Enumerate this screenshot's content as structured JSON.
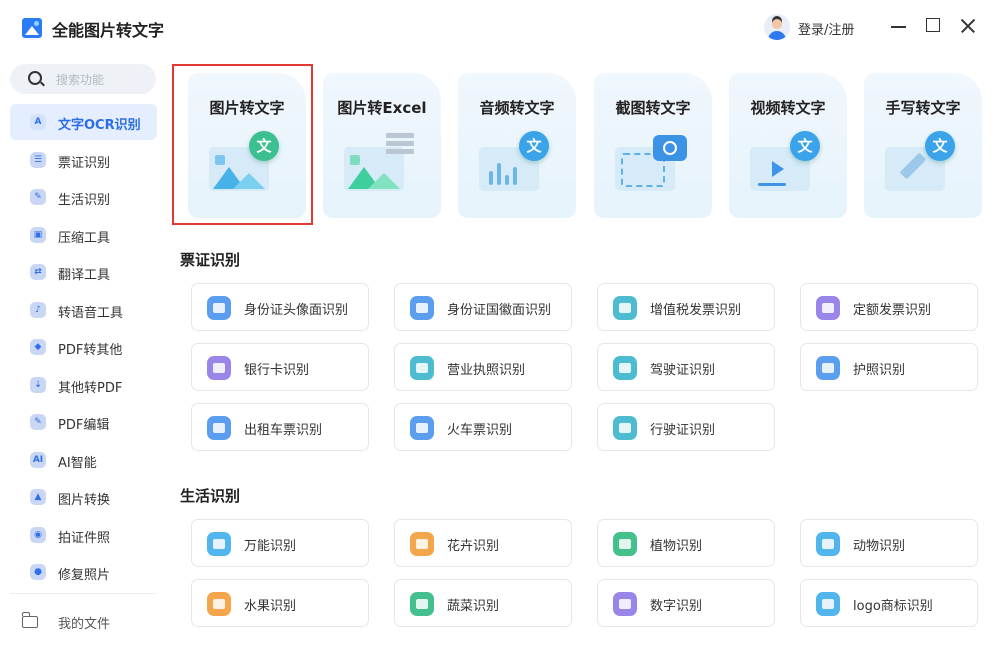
{
  "app": {
    "title": "全能图片转文字"
  },
  "header": {
    "login_label": "登录/注册"
  },
  "search": {
    "placeholder": "搜索功能"
  },
  "sidebar": {
    "items": [
      {
        "label": "文字OCR识别",
        "icon": "A"
      },
      {
        "label": "票证识别",
        "icon": "☰"
      },
      {
        "label": "生活识别",
        "icon": "✎"
      },
      {
        "label": "压缩工具",
        "icon": "▣"
      },
      {
        "label": "翻译工具",
        "icon": "⇄"
      },
      {
        "label": "转语音工具",
        "icon": "♪"
      },
      {
        "label": "PDF转其他",
        "icon": "◆"
      },
      {
        "label": "其他转PDF",
        "icon": "⇣"
      },
      {
        "label": "PDF编辑",
        "icon": "✎"
      },
      {
        "label": "AI智能",
        "icon": "AI"
      },
      {
        "label": "图片转换",
        "icon": "▲"
      },
      {
        "label": "拍证件照",
        "icon": "◉"
      },
      {
        "label": "修复照片",
        "icon": "●"
      }
    ],
    "my_files": "我的文件"
  },
  "features": [
    {
      "label": "图片转文字",
      "badge": "文"
    },
    {
      "label": "图片转Excel"
    },
    {
      "label": "音频转文字",
      "badge": "文"
    },
    {
      "label": "截图转文字"
    },
    {
      "label": "视频转文字",
      "badge": "文"
    },
    {
      "label": "手写转文字",
      "badge": "文"
    }
  ],
  "sections": {
    "tickets": {
      "title": "票证识别",
      "items": [
        "身份证头像面识别",
        "身份证国徽面识别",
        "增值税发票识别",
        "定额发票识别",
        "银行卡识别",
        "营业执照识别",
        "驾驶证识别",
        "护照识别",
        "出租车票识别",
        "火车票识别",
        "行驶证识别"
      ]
    },
    "life": {
      "title": "生活识别",
      "items": [
        "万能识别",
        "花卉识别",
        "植物识别",
        "动物识别",
        "水果识别",
        "蔬菜识别",
        "数字识别",
        "logo商标识别"
      ]
    }
  },
  "colors": {
    "accent": "#2b6de8",
    "highlight_border": "#e23a32"
  }
}
